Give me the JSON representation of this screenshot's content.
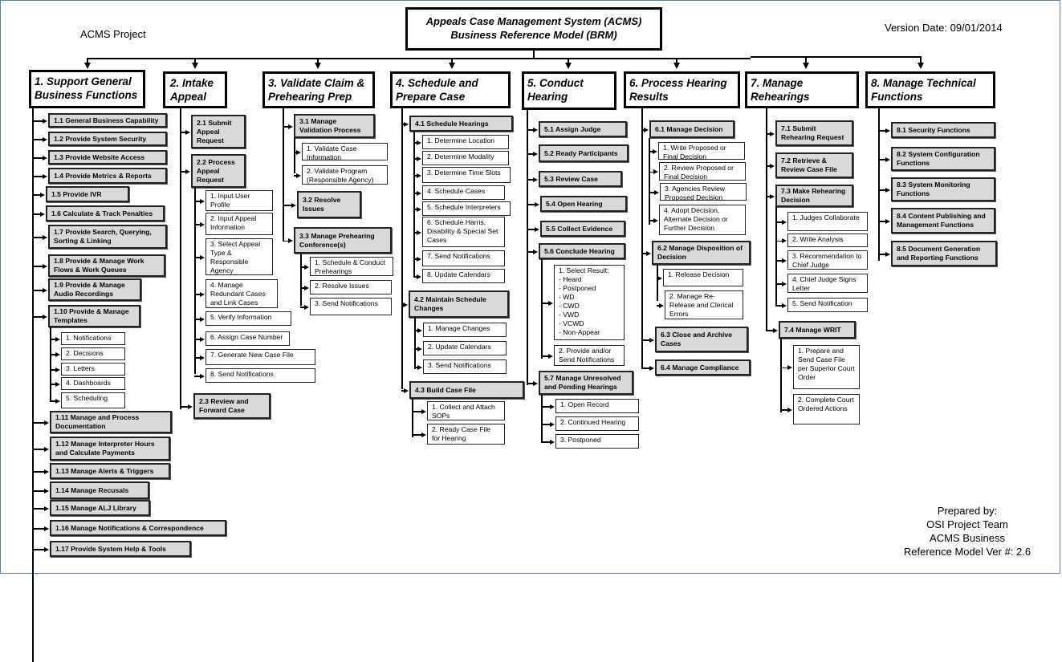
{
  "header": {
    "project": "ACMS Project",
    "title_line1": "Appeals Case Management System (ACMS)",
    "title_line2": "Business Reference Model (BRM)",
    "version_date": "Version Date: 09/01/2014"
  },
  "footer": {
    "line1": "Prepared by:",
    "line2": "OSI Project Team",
    "line3": "ACMS Business",
    "line4": "Reference Model Ver #: 2.6"
  },
  "columns": [
    {
      "title": "1. Support General Business Functions",
      "items": [
        {
          "label": "1.1 General Business Capability"
        },
        {
          "label": "1.2 Provide System Security"
        },
        {
          "label": "1.3 Provide Website Access"
        },
        {
          "label": "1.4 Provide Metrics & Reports"
        },
        {
          "label": "1.5  Provide IVR"
        },
        {
          "label": "1.6 Calculate & Track Penalties"
        },
        {
          "label": "1.7 Provide Search, Querying, Sorting & Linking"
        },
        {
          "label": "1.8 Provide & Manage Work Flows & Work Queues"
        },
        {
          "label": "1.9 Provide & Manage Audio Recordings"
        },
        {
          "label": "1.10 Provide & Manage Templates",
          "children": [
            "1. Notifications",
            "2. Decisions",
            "3. Letters",
            "4. Dashboards",
            "5. Scheduling"
          ]
        },
        {
          "label": "1.11 Manage and Process Documentation"
        },
        {
          "label": "1.12  Manage Interpreter Hours and Calculate Payments"
        },
        {
          "label": "1.13  Manage Alerts & Triggers"
        },
        {
          "label": "1.14  Manage Recusals"
        },
        {
          "label": "1.15  Manage ALJ Library"
        },
        {
          "label": "1.16  Manage Notifications & Correspondence"
        },
        {
          "label": "1.17  Provide System Help & Tools"
        }
      ]
    },
    {
      "title": "2. Intake Appeal",
      "items": [
        {
          "label": "2.1 Submit Appeal Request"
        },
        {
          "label": "2.2 Process Appeal Request",
          "children": [
            "1. Input User Profile",
            "2. Input Appeal Information",
            "3. Select Appeal Type & Responsible Agency",
            "4. Manage Redundant Cases and Link Cases",
            "5. Verify Information",
            "6. Assign Case Number",
            "7. Generate New Case File",
            "8. Send Notifications"
          ]
        },
        {
          "label": "2.3 Review and Forward Case"
        }
      ]
    },
    {
      "title": "3. Validate Claim & Prehearing Prep",
      "items": [
        {
          "label": "3.1 Manage Validation Process",
          "children": [
            "1. Validate Case Information",
            "2. Validate Program (Responsible Agency)"
          ]
        },
        {
          "label": "3.2 Resolve Issues"
        },
        {
          "label": "3.3 Manage Prehearing Conference(s)",
          "children": [
            "1. Schedule & Conduct Prehearings",
            "2. Resolve Issues",
            "3. Send Notifications"
          ]
        }
      ]
    },
    {
      "title": "4.  Schedule and Prepare Case",
      "items": [
        {
          "label": "4.1 Schedule Hearings",
          "children": [
            "1. Determine Location",
            "2. Determine Modality",
            "3. Determine Time Slots",
            "4. Schedule Cases",
            "5. Schedule Interpreters",
            "6. Schedule Harris, Disability & Special Set Cases",
            "7. Send Notifications",
            "8. Update Calendars"
          ]
        },
        {
          "label": "4.2 Maintain Schedule Changes",
          "children": [
            "1. Manage Changes",
            "2. Update Calendars",
            "3. Send Notifications"
          ]
        },
        {
          "label": "4.3 Build Case File",
          "children": [
            "1. Collect and Attach SOPs",
            "2. Ready Case File for Hearing"
          ]
        }
      ]
    },
    {
      "title": "5.  Conduct Hearing",
      "items": [
        {
          "label": "5.1 Assign Judge"
        },
        {
          "label": "5.2 Ready Participants"
        },
        {
          "label": "5.3 Review Case"
        },
        {
          "label": "5.4 Open Hearing"
        },
        {
          "label": "5.5 Collect Evidence"
        },
        {
          "label": "5.6 Conclude Hearing",
          "children": [
            "1. Select Result:\n  - Heard\n  - Postponed\n  - WD\n  - CWD\n  - VWD\n  - VCWD\n  - Non-Appear",
            "2. Provide and/or Send Notifications"
          ]
        },
        {
          "label": "5.7 Manage Unresolved and Pending Hearings",
          "children": [
            "1. Open Record",
            "2. Continued Hearing",
            "3. Postponed"
          ]
        }
      ]
    },
    {
      "title": "6.  Process Hearing Results",
      "items": [
        {
          "label": "6.1 Manage Decision",
          "children": [
            "1. Write Proposed or Final Decision",
            "2. Review Proposed or Final Decision",
            "3. Agencies Review Proposed Decision",
            "4. Adopt Decision, Alternate Decision or Further Decision"
          ]
        },
        {
          "label": "6.2  Manage Disposition of Decision",
          "children": [
            "1. Release Decision",
            "2. Manage Re-Release and Clerical Errors"
          ]
        },
        {
          "label": "6.3 Close and Archive Cases"
        },
        {
          "label": "6.4 Manage Compliance"
        }
      ]
    },
    {
      "title": "7. Manage Rehearings",
      "items": [
        {
          "label": "7.1  Submit Rehearing Request"
        },
        {
          "label": "7.2   Retrieve & Review Case File"
        },
        {
          "label": "7.3    Make Rehearing Decision",
          "children": [
            "1. Judges Collaborate",
            "2. Write Analysis",
            "3. Recommendation to Chief Judge",
            "4. Chief Judge Signs Letter",
            "5. Send Notification"
          ]
        },
        {
          "label": "7.4  Manage WRIT",
          "children": [
            "1. Prepare and Send Case File per Superior Court Order",
            "2. Complete Court Ordered Actions"
          ]
        }
      ]
    },
    {
      "title": "8. Manage Technical Functions",
      "items": [
        {
          "label": "8.1 Security Functions"
        },
        {
          "label": "8.2 System Configuration Functions"
        },
        {
          "label": "8.3 System Monitoring Functions"
        },
        {
          "label": "8.4 Content Publishing and Management Functions"
        },
        {
          "label": "8.5 Document Generation and Reporting Functions"
        }
      ]
    }
  ]
}
